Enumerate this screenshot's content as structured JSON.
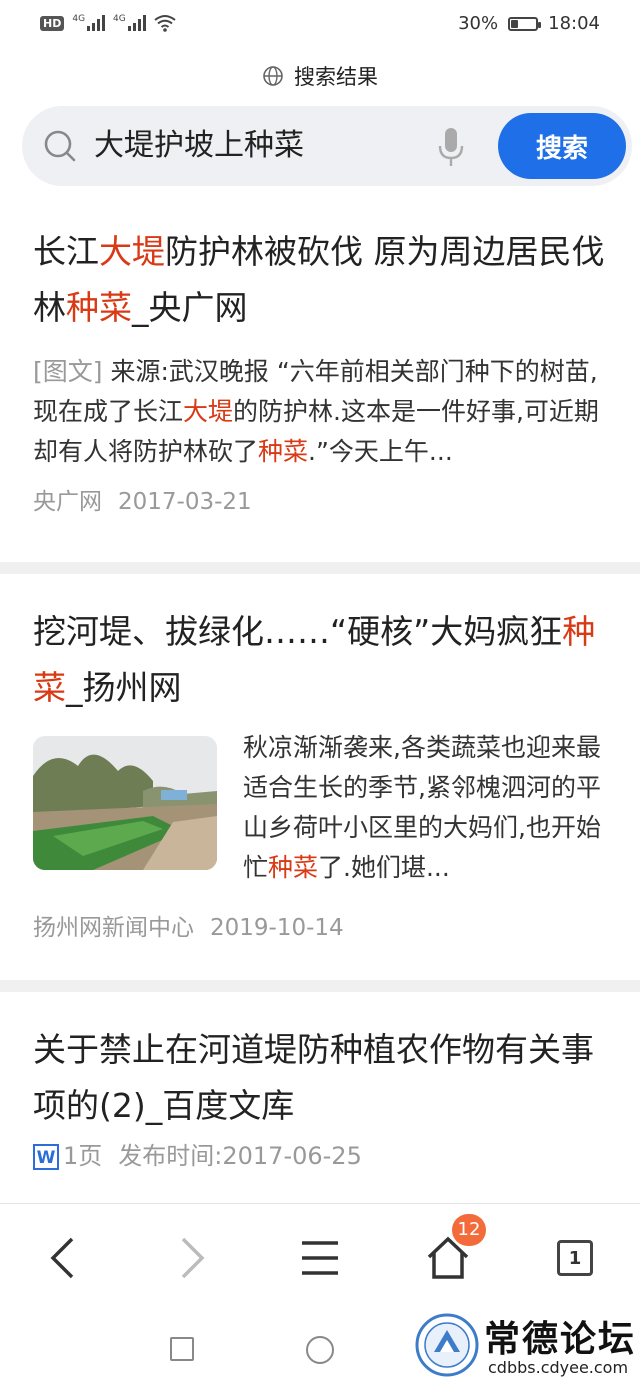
{
  "status_bar": {
    "hd": "HD",
    "sim1_label": "4G",
    "sim2_label": "4G",
    "battery_percent": "30%",
    "battery_level": 0.3,
    "time": "18:04"
  },
  "header": {
    "title": "搜索结果",
    "globe_icon": "globe-icon"
  },
  "search": {
    "query": "大堤护坡上种菜",
    "button_label": "搜索",
    "icons": [
      "search-icon",
      "mic-icon"
    ]
  },
  "results": [
    {
      "title_parts": [
        "长江",
        "大堤",
        "防护林被砍伐 原为周边居民伐林",
        "种菜",
        "_央广网"
      ],
      "tag": "[图文]",
      "snippet_parts": [
        " 来源:武汉晚报 “六年前相关部门种下的树苗,现在成了长江",
        "大堤",
        "的防护林.这本是一件好事,可近期却有人将防护林砍了",
        "种菜",
        ".”今天上午..."
      ],
      "source": "央广网",
      "date": "2017-03-21"
    },
    {
      "title_parts": [
        "挖河堤、拔绿化……“硬核”大妈疯狂",
        "种菜",
        "_扬州网"
      ],
      "snippet_parts": [
        "秋凉渐渐袭来,各类蔬菜也迎来最适合生长的季节,紧邻槐泗河的平山乡荷叶小区里的大妈们,也开始忙",
        "种菜",
        "了.她们堪..."
      ],
      "source": "扬州网新闻中心",
      "date": "2019-10-14"
    },
    {
      "title": "关于禁止在河道堤防种植农作物有关事项的(2)_百度文库",
      "doc_icon": "W",
      "pages": "1页",
      "publish_label": "发布时间:2017-06-25"
    }
  ],
  "bottom_nav": {
    "icons": [
      "back-icon",
      "forward-icon",
      "menu-icon",
      "home-icon",
      "tabs-icon"
    ],
    "home_badge": "12",
    "tabs_count": "1"
  },
  "watermark": {
    "name": "常德论坛",
    "url": "cdbbs.cdyee.com"
  }
}
